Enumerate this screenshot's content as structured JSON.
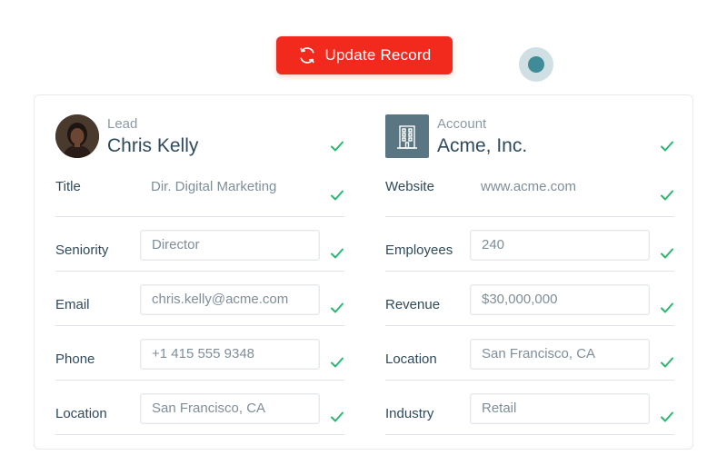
{
  "toolbar": {
    "update_label": "Update Record",
    "update_icon": "refresh-icon",
    "accent": "#f2291d"
  },
  "lead": {
    "type_label": "Lead",
    "name": "Chris Kelly",
    "fields": [
      {
        "label": "Title",
        "value": "Dir. Digital Marketing",
        "editable": false
      },
      {
        "label": "Seniority",
        "value": "Director",
        "editable": true
      },
      {
        "label": "Email",
        "value": "chris.kelly@acme.com",
        "editable": true
      },
      {
        "label": "Phone",
        "value": "+1 415 555 9348",
        "editable": true
      },
      {
        "label": "Location",
        "value": "San Francisco, CA",
        "editable": true
      }
    ]
  },
  "account": {
    "type_label": "Account",
    "name": "Acme, Inc.",
    "icon": "building-icon",
    "fields": [
      {
        "label": "Website",
        "value": "www.acme.com",
        "editable": false
      },
      {
        "label": "Employees",
        "value": "240",
        "editable": true
      },
      {
        "label": "Revenue",
        "value": "$30,000,000",
        "editable": true
      },
      {
        "label": "Location",
        "value": "San Francisco, CA",
        "editable": true
      },
      {
        "label": "Industry",
        "value": "Retail",
        "editable": true
      }
    ]
  },
  "colors": {
    "check": "#2bb673",
    "text": "#2f4a5a",
    "muted": "#7f8e98"
  }
}
